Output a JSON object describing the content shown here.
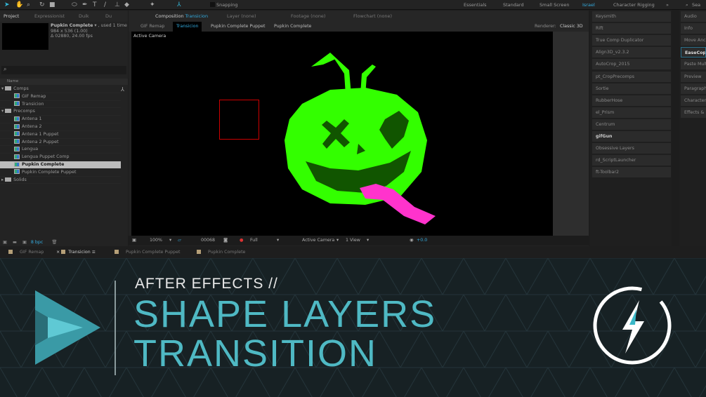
{
  "toolbar": {
    "snapping": "Snapping",
    "workspaces": [
      "Essentials",
      "Standard",
      "Small Screen",
      "Israel",
      "Character Rigging"
    ],
    "search": "Sea"
  },
  "panel_tabs": {
    "project": "Project",
    "expressionist": "Expressionist",
    "duik": "Duik",
    "du": "Du",
    "composition": "Composition",
    "comp_name": "Transicion",
    "layer": "Layer (none)",
    "footage": "Footage (none)",
    "flowchart": "Flowchart (none)"
  },
  "project": {
    "item_name": "Pupkin Complete",
    "used": ", used 1 time",
    "dims": "984 x 536 (1.00)",
    "duration": "Δ 02880, 24.00 fps",
    "col_name": "Name",
    "bpc": "8 bpc",
    "items": [
      {
        "label": "Comps",
        "type": "folder"
      },
      {
        "label": "GIF Remap",
        "type": "comp"
      },
      {
        "label": "Transicion",
        "type": "comp"
      },
      {
        "label": "Precomps",
        "type": "folder"
      },
      {
        "label": "Antena 1",
        "type": "comp"
      },
      {
        "label": "Antena 2",
        "type": "comp"
      },
      {
        "label": "Antena 1 Puppet",
        "type": "comp"
      },
      {
        "label": "Antena 2 Puppet",
        "type": "comp"
      },
      {
        "label": "Lengua",
        "type": "comp"
      },
      {
        "label": "Lengua Puppet Comp",
        "type": "comp"
      },
      {
        "label": "Pupkin Complete",
        "type": "comp",
        "selected": true
      },
      {
        "label": "Pupkin Complete Puppet",
        "type": "comp"
      },
      {
        "label": "Solids",
        "type": "folder"
      }
    ]
  },
  "comp": {
    "breadcrumbs": [
      "GIF Remap",
      "Transicion",
      "Pupkin Complete Puppet",
      "Pupkin Complete"
    ],
    "renderer_label": "Renderer:",
    "renderer": "Classic 3D",
    "view_label": "Active Camera",
    "controls": {
      "zoom": "100%",
      "timecode": "00068",
      "resolution": "Full",
      "camera": "Active Camera",
      "views": "1 View",
      "exposure": "+0.0"
    }
  },
  "scripts": [
    "Keysmith",
    "Rift",
    "True Comp Duplicator",
    "Align3D_v2.3.2",
    "AutoCrop_2015",
    "pt_CropPrecomps",
    "Sortie",
    "RubberHose",
    "el_Prism",
    "Centrum",
    "gifGun",
    "Obsessive Layers",
    "rd_ScriptLauncher",
    "ft-Toolbar2"
  ],
  "right_panel": [
    "Audio",
    "Info",
    "Move Anch",
    "EaseCopy",
    "Paste Multi",
    "Preview",
    "Paragraph",
    "Character",
    "Effects & P"
  ],
  "timeline_tabs": [
    "GIF Remap",
    "Transicion",
    "Pupkin Complete Puppet",
    "Pupkin Complete"
  ],
  "banner": {
    "subtitle": "AFTER EFFECTS //",
    "title_line1": "SHAPE LAYERS",
    "title_line2": "TRANSITION"
  },
  "colors": {
    "accent": "#4fb9c4",
    "pumpkin": "#33ff00",
    "tongue": "#ff33cc"
  }
}
